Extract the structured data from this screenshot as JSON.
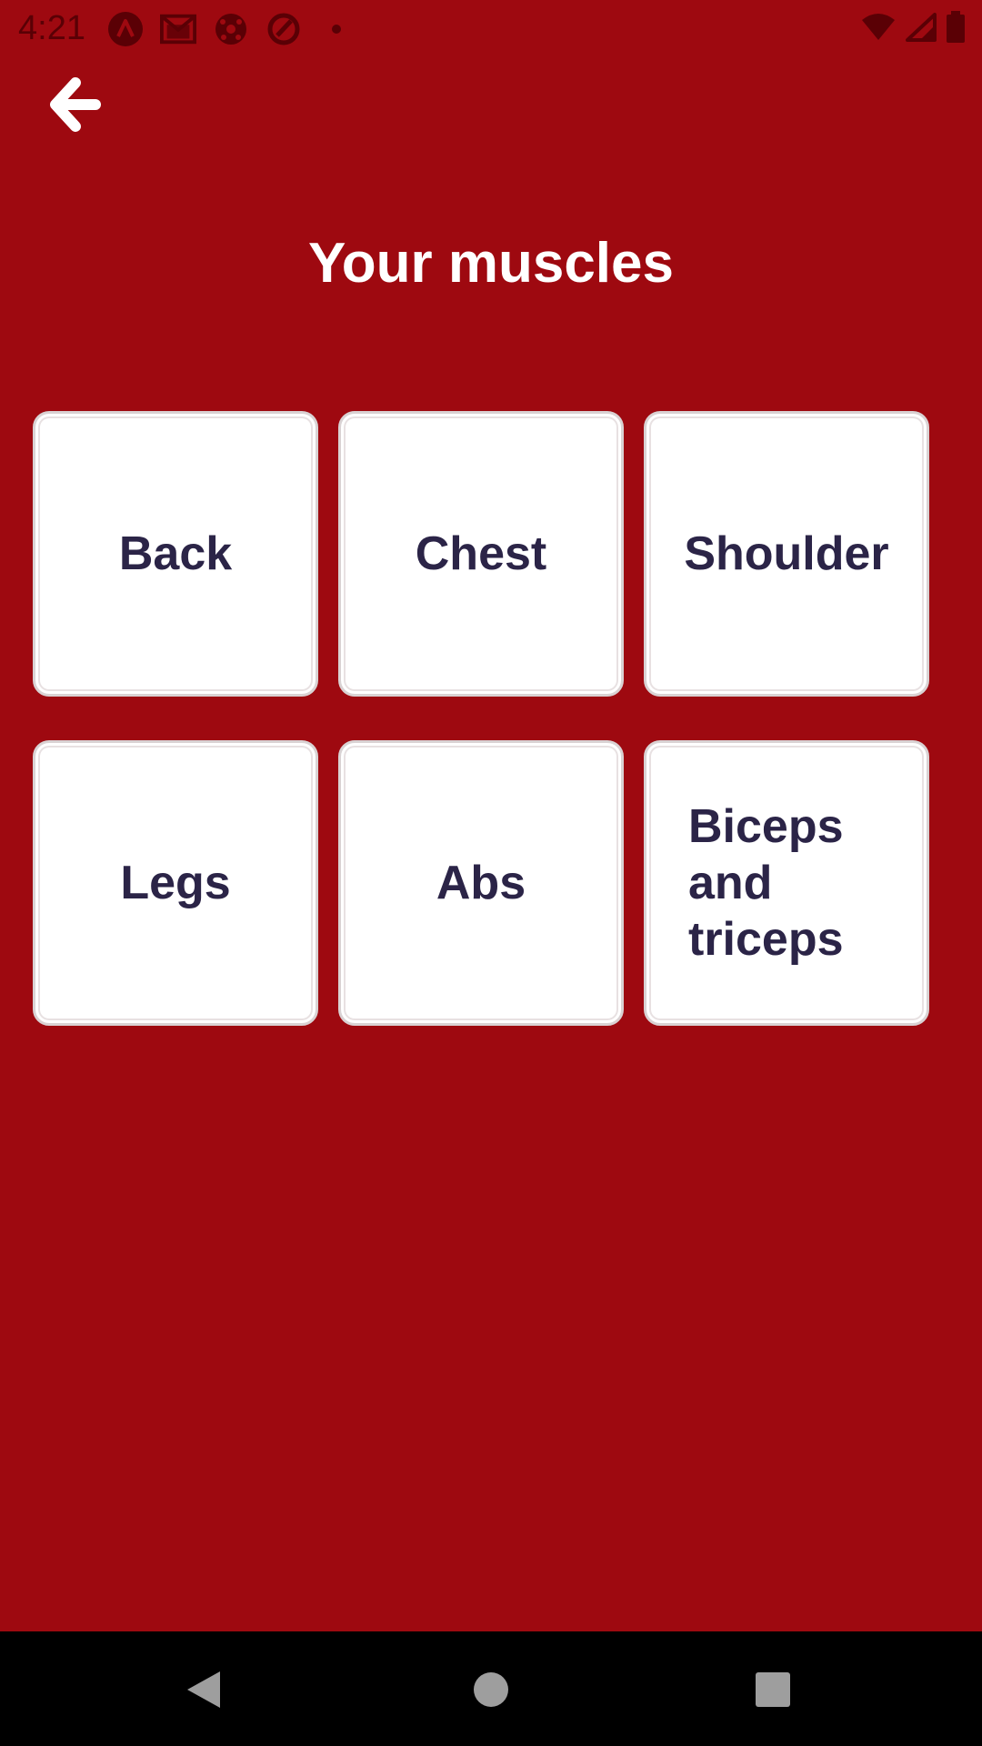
{
  "status_bar": {
    "time": "4:21",
    "icons": [
      "app-a-icon",
      "gmail-icon",
      "soccer-ball-icon",
      "at-sign-icon",
      "dot-icon",
      "wifi-icon",
      "signal-icon",
      "battery-icon"
    ]
  },
  "header": {
    "back_icon": "arrow-left-icon",
    "title": "Your muscles"
  },
  "muscle_groups": [
    {
      "label": "Back"
    },
    {
      "label": "Chest"
    },
    {
      "label": "Shoulder"
    },
    {
      "label": "Legs"
    },
    {
      "label": "Abs"
    },
    {
      "label": "Biceps and triceps"
    }
  ],
  "nav_bar": {
    "buttons": [
      "nav-back-icon",
      "nav-home-icon",
      "nav-recents-icon"
    ]
  },
  "colors": {
    "background": "#9e0910",
    "card_text": "#2b2447",
    "title_text": "#ffffff"
  }
}
